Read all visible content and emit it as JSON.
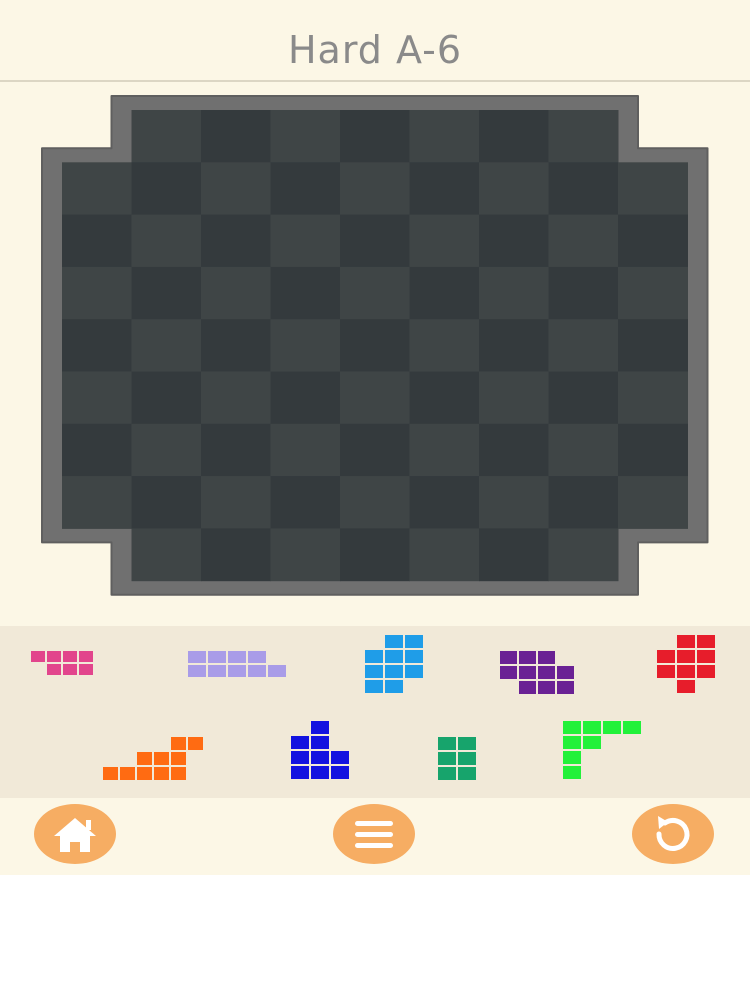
{
  "header": {
    "title": "Hard A-6"
  },
  "board": {
    "rows": 8,
    "cols": 9,
    "cell_colors": [
      "#343a3d",
      "#3f4546"
    ],
    "frame_color": "#707070",
    "missing_cells": [
      [
        0,
        0
      ],
      [
        0,
        8
      ],
      [
        7,
        0
      ],
      [
        7,
        8
      ]
    ]
  },
  "pieces": [
    {
      "id": "pink",
      "color": "#e2458c",
      "cells": [
        [
          0,
          0
        ],
        [
          0,
          1
        ],
        [
          1,
          1
        ],
        [
          1,
          2
        ],
        [
          1,
          3
        ],
        [
          0,
          2
        ],
        [
          0,
          3
        ]
      ]
    },
    {
      "id": "lavender",
      "color": "#a99ce8",
      "cells": [
        [
          0,
          0
        ],
        [
          0,
          1
        ],
        [
          0,
          2
        ],
        [
          0,
          3
        ],
        [
          1,
          0
        ],
        [
          1,
          1
        ],
        [
          1,
          2
        ],
        [
          1,
          3
        ],
        [
          1,
          4
        ]
      ]
    },
    {
      "id": "cyan",
      "color": "#1f9de8",
      "cells": [
        [
          0,
          1
        ],
        [
          0,
          2
        ],
        [
          1,
          0
        ],
        [
          1,
          1
        ],
        [
          1,
          2
        ],
        [
          2,
          0
        ],
        [
          2,
          1
        ],
        [
          2,
          2
        ],
        [
          3,
          0
        ],
        [
          3,
          1
        ]
      ]
    },
    {
      "id": "purple",
      "color": "#6a2194",
      "cells": [
        [
          0,
          0
        ],
        [
          0,
          1
        ],
        [
          0,
          2
        ],
        [
          1,
          0
        ],
        [
          1,
          1
        ],
        [
          1,
          2
        ],
        [
          1,
          3
        ],
        [
          2,
          1
        ],
        [
          2,
          2
        ],
        [
          2,
          3
        ]
      ]
    },
    {
      "id": "red",
      "color": "#e71d2b",
      "cells": [
        [
          0,
          1
        ],
        [
          0,
          2
        ],
        [
          1,
          0
        ],
        [
          1,
          1
        ],
        [
          1,
          2
        ],
        [
          2,
          0
        ],
        [
          2,
          1
        ],
        [
          2,
          2
        ],
        [
          3,
          1
        ]
      ]
    },
    {
      "id": "orange",
      "color": "#ff6b12",
      "cells": [
        [
          0,
          4
        ],
        [
          0,
          5
        ],
        [
          1,
          2
        ],
        [
          1,
          3
        ],
        [
          1,
          4
        ],
        [
          2,
          0
        ],
        [
          2,
          1
        ],
        [
          2,
          2
        ],
        [
          2,
          3
        ],
        [
          2,
          4
        ]
      ]
    },
    {
      "id": "blue",
      "color": "#1212e0",
      "cells": [
        [
          0,
          1
        ],
        [
          1,
          0
        ],
        [
          1,
          1
        ],
        [
          2,
          0
        ],
        [
          2,
          1
        ],
        [
          2,
          2
        ],
        [
          3,
          0
        ],
        [
          3,
          1
        ],
        [
          3,
          2
        ]
      ]
    },
    {
      "id": "green",
      "color": "#17a46c",
      "cells": [
        [
          0,
          0
        ],
        [
          0,
          1
        ],
        [
          1,
          0
        ],
        [
          1,
          1
        ],
        [
          2,
          0
        ],
        [
          2,
          1
        ]
      ]
    },
    {
      "id": "lime",
      "color": "#22f13a",
      "cells": [
        [
          0,
          0
        ],
        [
          0,
          1
        ],
        [
          0,
          2
        ],
        [
          0,
          3
        ],
        [
          1,
          0
        ],
        [
          1,
          1
        ],
        [
          2,
          0
        ],
        [
          3,
          0
        ]
      ]
    }
  ],
  "controls": {
    "button_color": "#f6ad63",
    "icons": [
      "home-icon",
      "menu-icon",
      "restart-icon"
    ]
  }
}
